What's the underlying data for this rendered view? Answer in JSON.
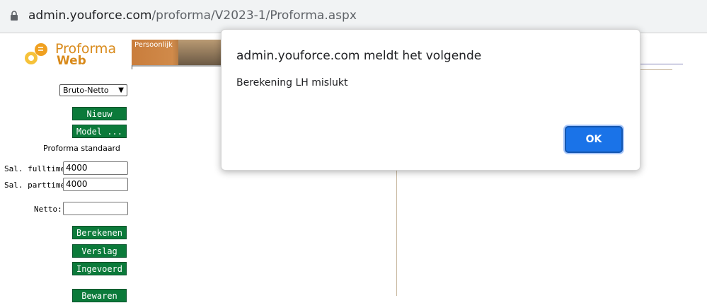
{
  "browser": {
    "url_host": "admin.youforce.com",
    "url_path": "/proforma/V2023-1/Proforma.aspx"
  },
  "logo": {
    "word1": "Proforma",
    "word2": "Web"
  },
  "tabs": {
    "persoonlijk": "Persoonlijk"
  },
  "sidebar": {
    "mode_select_value": "Bruto-Netto",
    "new_button": "Nieuw",
    "model_button": "Model ...",
    "proforma_label": "Proforma standaard",
    "fulltime_label": "Sal. fulltime:",
    "fulltime_value": "4000",
    "parttime_label": "Sal. parttime:",
    "parttime_value": "4000",
    "netto_label": "Netto:",
    "netto_value": "",
    "calculate_button": "Berekenen",
    "report_button": "Verslag",
    "entered_button": "Ingevoerd",
    "save_button": "Bewaren"
  },
  "dialog": {
    "title": "admin.youforce.com meldt het volgende",
    "message": "Berekening LH mislukt",
    "ok_label": "OK"
  },
  "colors": {
    "green_button": "#0b7a3a",
    "ok_blue": "#1a73e8",
    "logo_orange": "#d98a1a"
  }
}
